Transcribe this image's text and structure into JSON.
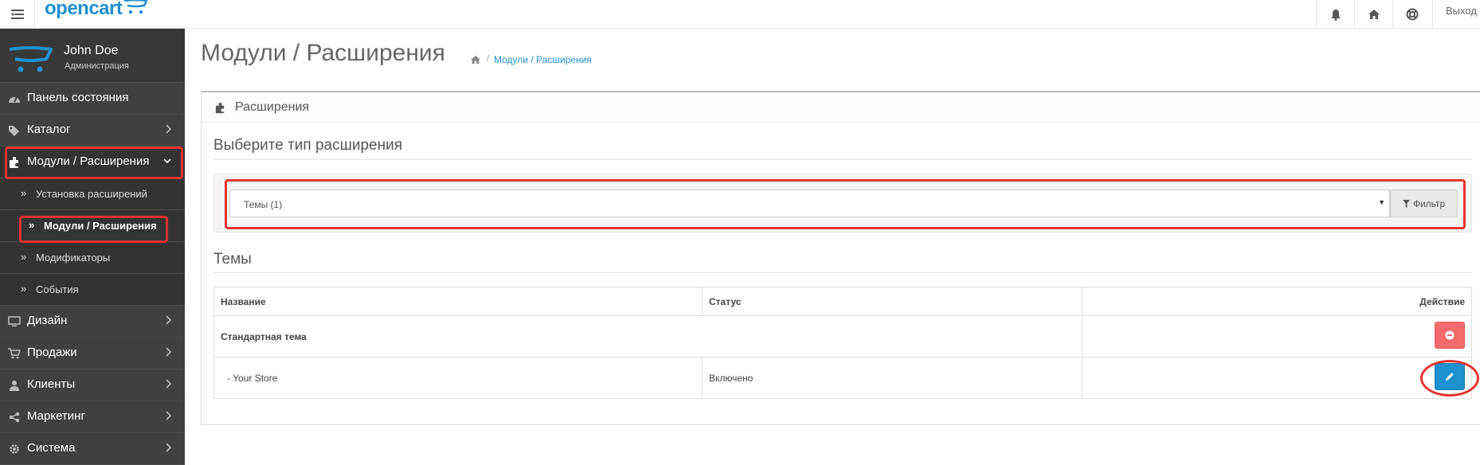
{
  "header": {
    "logo": "opencart",
    "logout": "Выход"
  },
  "sidebar": {
    "user": {
      "name": "John Doe",
      "role": "Администрация"
    },
    "items": [
      {
        "label": "Панель состояния",
        "icon": "dashboard-icon",
        "has_chevron": false
      },
      {
        "label": "Каталог",
        "icon": "tags-icon",
        "has_chevron": true
      },
      {
        "label": "Модули / Расширения",
        "icon": "puzzle-icon",
        "has_chevron": true,
        "expanded": true
      },
      {
        "label": "Дизайн",
        "icon": "monitor-icon",
        "has_chevron": true
      },
      {
        "label": "Продажи",
        "icon": "cart-icon",
        "has_chevron": true
      },
      {
        "label": "Клиенты",
        "icon": "user-icon",
        "has_chevron": true
      },
      {
        "label": "Маркетинг",
        "icon": "share-icon",
        "has_chevron": true
      },
      {
        "label": "Система",
        "icon": "cog-icon",
        "has_chevron": true
      }
    ],
    "subitems": [
      {
        "label": "Установка расширений",
        "active": false
      },
      {
        "label": "Модули / Расширения",
        "active": true
      },
      {
        "label": "Модификаторы",
        "active": false
      },
      {
        "label": "События",
        "active": false
      }
    ]
  },
  "page": {
    "title": "Модули / Расширения",
    "breadcrumb": "Модули / Расширения",
    "panel_title": "Расширения",
    "choose_heading": "Выберите тип расширения",
    "filter": {
      "selected": "Темы (1)",
      "button": "Фильтр"
    },
    "list_heading": "Темы",
    "table": {
      "headers": [
        "Название",
        "Статус",
        "Действие"
      ],
      "group": "Стандартная тема",
      "rows": [
        {
          "name": "-  Your Store",
          "status": "Включено"
        }
      ]
    }
  },
  "colors": {
    "accent": "#1e91cf",
    "danger": "#f56b6b",
    "annotation": "#e3342f",
    "sidebar": "#2a2a2a"
  }
}
